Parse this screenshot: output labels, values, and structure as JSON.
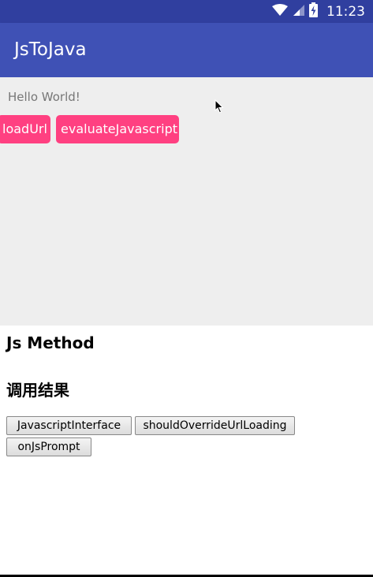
{
  "status_bar": {
    "time": "11:23",
    "icons": [
      "wifi-icon",
      "signal-icon",
      "battery-charging-icon"
    ]
  },
  "app_bar": {
    "title": "JsToJava"
  },
  "native": {
    "hello_text": "Hello World!",
    "buttons": [
      "loadUrl",
      "evaluateJavascript"
    ]
  },
  "webview": {
    "heading_method": "Js Method",
    "heading_result": "调用结果",
    "buttons": [
      "JavascriptInterface",
      "shouldOverrideUrlLoading",
      "onJsPrompt"
    ]
  },
  "colors": {
    "status_bar": "#303f9f",
    "app_bar": "#3f51b5",
    "accent": "#ff4081",
    "native_background": "#eeeeee"
  }
}
